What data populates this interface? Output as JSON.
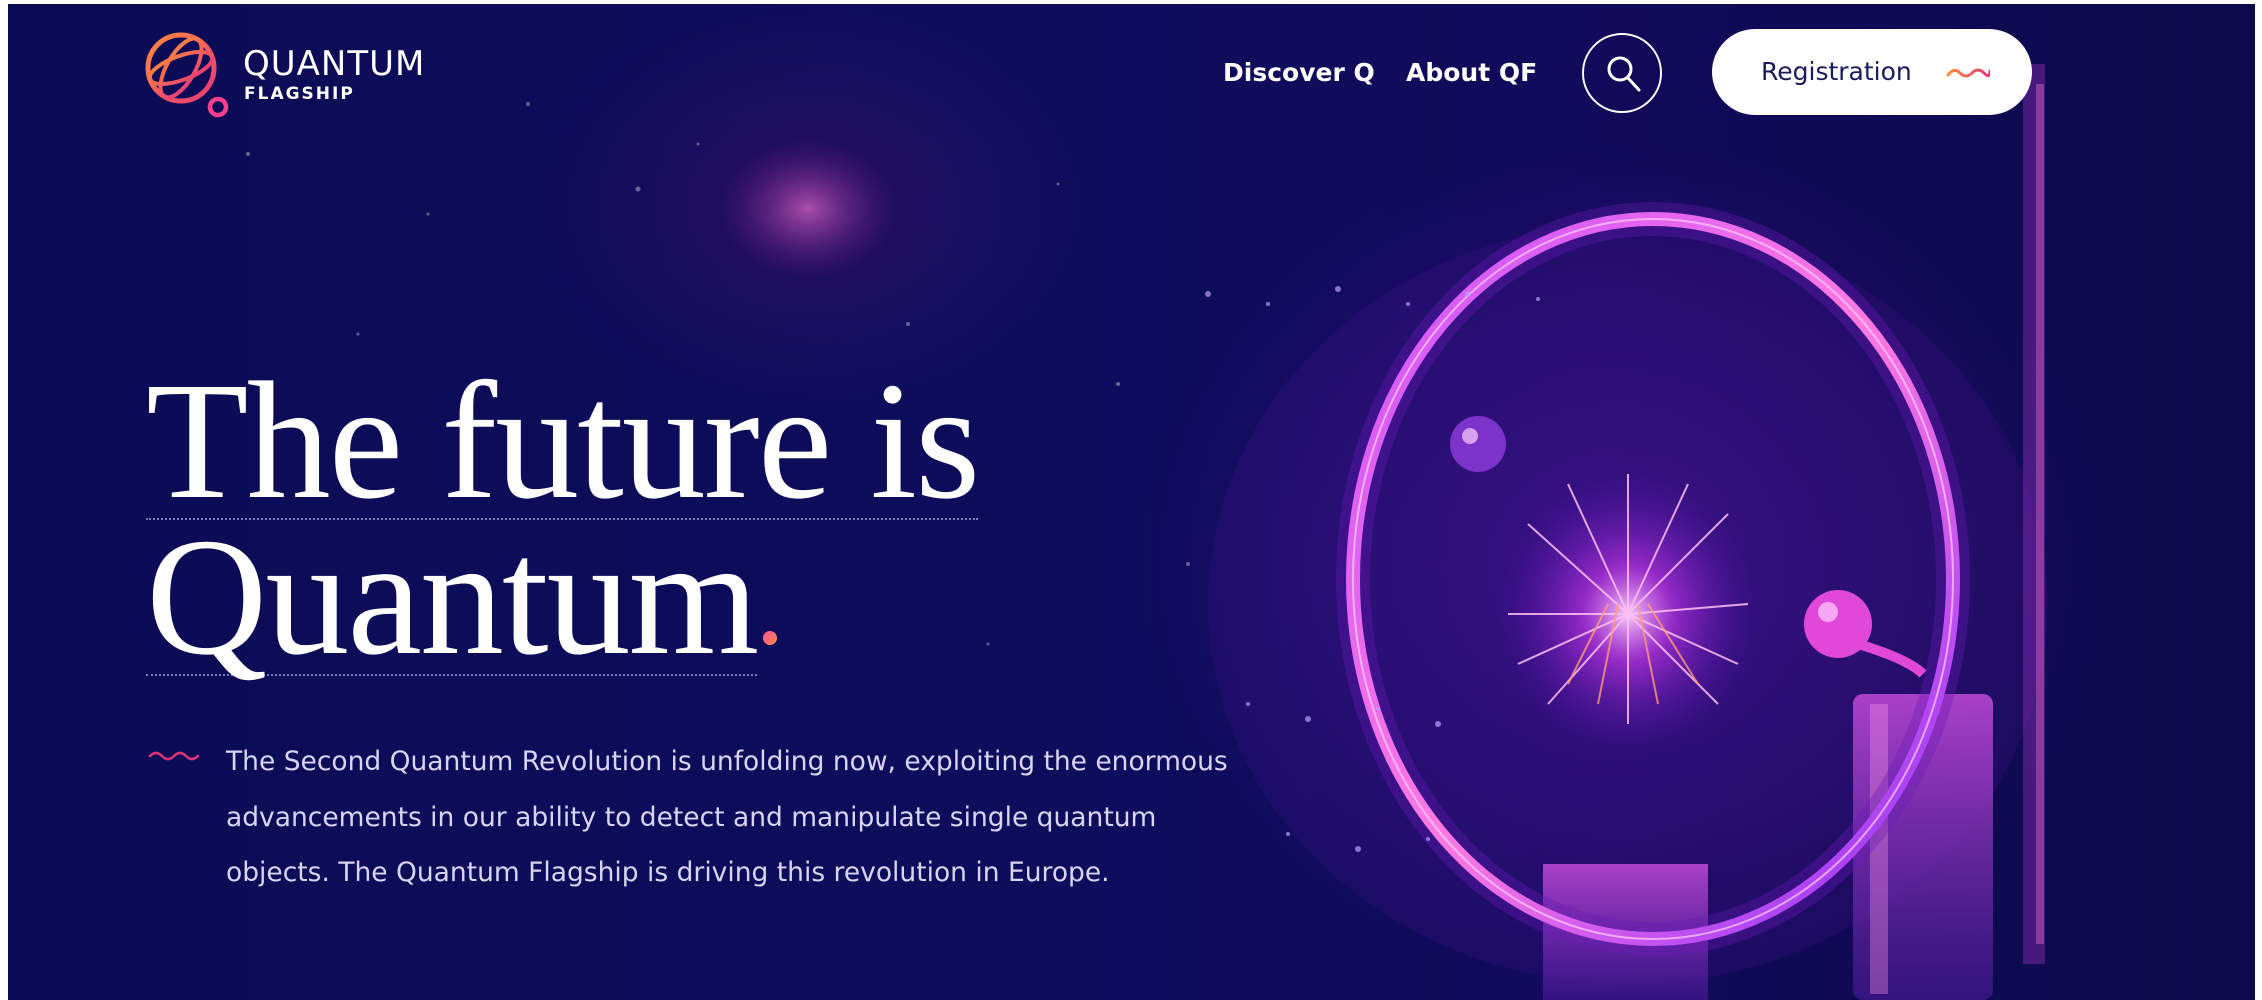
{
  "brand": {
    "name_main": "QUANTUM",
    "name_sub": "FLAGSHIP"
  },
  "nav": {
    "items": [
      {
        "label": "Discover Q"
      },
      {
        "label": "About QF"
      }
    ],
    "search_icon": "search-icon",
    "registration_label": "Registration",
    "registration_icon": "wave-icon"
  },
  "hero": {
    "headline_line1": "The future is",
    "headline_line2": "Quantum",
    "paragraph": "The Second Quantum Revolution is unfolding now, exploiting the enormous advancements in our ability to detect and manipulate single quantum objects. The Quantum Flagship is driving this revolution in Europe."
  },
  "colors": {
    "background": "#0d0d5c",
    "accent_pink": "#ff4fa0",
    "accent_orange": "#ff8a3d",
    "text_white": "#ffffff",
    "button_text": "#1a1a5e"
  }
}
